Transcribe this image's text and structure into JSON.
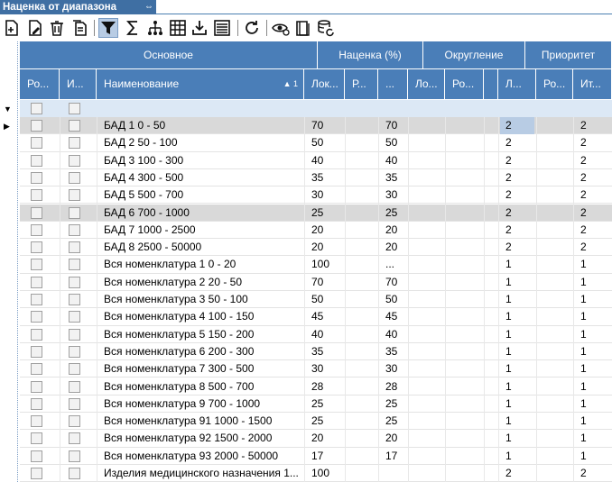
{
  "window": {
    "title": "Наценка от диапазона",
    "pin_glyph": "⇔"
  },
  "toolbar": {
    "buttons": [
      {
        "icon": "add-document-icon"
      },
      {
        "icon": "edit-document-icon"
      },
      {
        "icon": "delete-icon"
      },
      {
        "icon": "copy-document-icon"
      },
      {
        "icon": "filter-icon",
        "active": true
      },
      {
        "icon": "sum-icon"
      },
      {
        "icon": "hierarchy-icon"
      },
      {
        "icon": "grid-icon"
      },
      {
        "icon": "export-icon"
      },
      {
        "icon": "list-icon"
      },
      {
        "icon": "refresh-icon"
      },
      {
        "icon": "view-settings-icon"
      },
      {
        "icon": "book-icon"
      },
      {
        "icon": "database-refresh-icon"
      }
    ]
  },
  "grid": {
    "bands": [
      "Основное",
      "Наценка (%)",
      "Округление",
      "Приоритет"
    ],
    "columns": [
      "Ро...",
      "И...",
      "Наименование",
      "Лок...",
      "Р...",
      "...",
      "Ло...",
      "Ро...",
      "",
      "Л...",
      "Ро...",
      "Ит..."
    ],
    "sort_indicator": "▲ 1",
    "rows": [
      {
        "name": "БАД 1     0 - 50",
        "lok": "70",
        "col6": "70",
        "prio_l": "2",
        "prio_it": "2",
        "selected": true
      },
      {
        "name": "БАД 2     50 - 100",
        "lok": "50",
        "col6": "50",
        "prio_l": "2",
        "prio_it": "2"
      },
      {
        "name": "БАД 3     100 - 300",
        "lok": "40",
        "col6": "40",
        "prio_l": "2",
        "prio_it": "2"
      },
      {
        "name": "БАД 4     300 - 500",
        "lok": "35",
        "col6": "35",
        "prio_l": "2",
        "prio_it": "2"
      },
      {
        "name": "БАД 5     500 - 700",
        "lok": "30",
        "col6": "30",
        "prio_l": "2",
        "prio_it": "2"
      },
      {
        "name": "БАД 6     700 - 1000",
        "lok": "25",
        "col6": "25",
        "prio_l": "2",
        "prio_it": "2",
        "highlight": true
      },
      {
        "name": "БАД 7     1000 - 2500",
        "lok": "20",
        "col6": "20",
        "prio_l": "2",
        "prio_it": "2"
      },
      {
        "name": "БАД 8     2500 - 50000",
        "lok": "20",
        "col6": "20",
        "prio_l": "2",
        "prio_it": "2"
      },
      {
        "name": "Вся номенклатура 1     0 - 20",
        "lok": "100",
        "col6": "...",
        "prio_l": "1",
        "prio_it": "1"
      },
      {
        "name": "Вся номенклатура 2     20 - 50",
        "lok": "70",
        "col6": "70",
        "prio_l": "1",
        "prio_it": "1"
      },
      {
        "name": "Вся номенклатура 3     50 - 100",
        "lok": "50",
        "col6": "50",
        "prio_l": "1",
        "prio_it": "1"
      },
      {
        "name": "Вся номенклатура 4     100 - 150",
        "lok": "45",
        "col6": "45",
        "prio_l": "1",
        "prio_it": "1"
      },
      {
        "name": "Вся номенклатура 5     150 - 200",
        "lok": "40",
        "col6": "40",
        "prio_l": "1",
        "prio_it": "1"
      },
      {
        "name": "Вся номенклатура 6     200 - 300",
        "lok": "35",
        "col6": "35",
        "prio_l": "1",
        "prio_it": "1"
      },
      {
        "name": "Вся номенклатура 7     300 - 500",
        "lok": "30",
        "col6": "30",
        "prio_l": "1",
        "prio_it": "1"
      },
      {
        "name": "Вся номенклатура 8     500 - 700",
        "lok": "28",
        "col6": "28",
        "prio_l": "1",
        "prio_it": "1"
      },
      {
        "name": "Вся номенклатура 9     700 - 1000",
        "lok": "25",
        "col6": "25",
        "prio_l": "1",
        "prio_it": "1"
      },
      {
        "name": "Вся номенклатура 91     1000 - 1500",
        "lok": "25",
        "col6": "25",
        "prio_l": "1",
        "prio_it": "1"
      },
      {
        "name": "Вся номенклатура 92     1500 - 2000",
        "lok": "20",
        "col6": "20",
        "prio_l": "1",
        "prio_it": "1"
      },
      {
        "name": "Вся номенклатура 93     2000 - 50000",
        "lok": "17",
        "col6": "17",
        "prio_l": "1",
        "prio_it": "1"
      },
      {
        "name": "Изделия медицинского назначения 1...",
        "lok": "100",
        "col6": "",
        "prio_l": "2",
        "prio_it": "2"
      }
    ]
  },
  "colors": {
    "header": "#4a7eb8",
    "title": "#3f6fa3",
    "selected_row": "#d9d9d9",
    "filter_row": "#dce8f5"
  }
}
